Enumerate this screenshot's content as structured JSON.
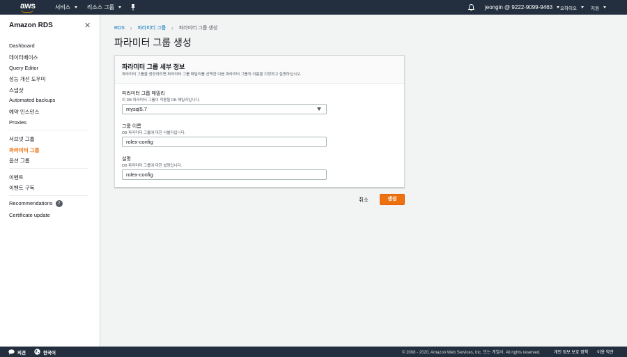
{
  "topnav": {
    "logo": "aws",
    "services": "서비스",
    "resource_groups": "리소스 그룹",
    "account": "jeongin @ 9222-9099-9463",
    "region": "오하이오",
    "support": "지원"
  },
  "sidebar": {
    "title": "Amazon RDS",
    "items": [
      {
        "label": "Dashboard"
      },
      {
        "label": "데이터베이스"
      },
      {
        "label": "Query Editor"
      },
      {
        "label": "성능 개선 도우미"
      },
      {
        "label": "스냅샷"
      },
      {
        "label": "Automated backups"
      },
      {
        "label": "예약 인스턴스"
      },
      {
        "label": "Proxies"
      },
      {
        "label": "서브넷 그룹"
      },
      {
        "label": "파라미터 그룹"
      },
      {
        "label": "옵션 그룹"
      },
      {
        "label": "이벤트"
      },
      {
        "label": "이벤트 구독"
      },
      {
        "label": "Recommendations",
        "badge": "2"
      },
      {
        "label": "Certificate update"
      }
    ]
  },
  "breadcrumb": [
    "RDS",
    "파라미터 그룹",
    "파라미터 그룹 생성"
  ],
  "page_title": "파라미터 그룹 생성",
  "panel": {
    "title": "파라미터 그룹 세부 정보",
    "description": "파라미터 그룹을 생성하려면 파라미터 그룹 패밀리를 선택한 다음 파라미터 그룹의 이름을 지정하고 설명하십시오.",
    "family": {
      "label": "파라미터 그룹 패밀리",
      "description": "이 DB 파라미터 그룹이 적용될 DB 패밀리입니다.",
      "value": "mysql5.7"
    },
    "group_name": {
      "label": "그룹 이름",
      "description": "DB 파라미터 그룹에 대한 식별자입니다.",
      "value": "rolex-config"
    },
    "desc_field": {
      "label": "설명",
      "description": "DB 파라미터 그룹에 대한 설명입니다.",
      "value": "rolex-config"
    }
  },
  "actions": {
    "cancel": "취소",
    "create": "생성"
  },
  "footer": {
    "feedback": "의견",
    "language": "한국어",
    "copyright": "© 2008 - 2020, Amazon Web Services, Inc. 또는 계열사. All rights reserved.",
    "privacy": "개인 정보 보호 정책",
    "terms": "이용 약관"
  },
  "colors": {
    "nav_bg": "#232f3e",
    "accent": "#ec7211",
    "link": "#0073bb"
  }
}
